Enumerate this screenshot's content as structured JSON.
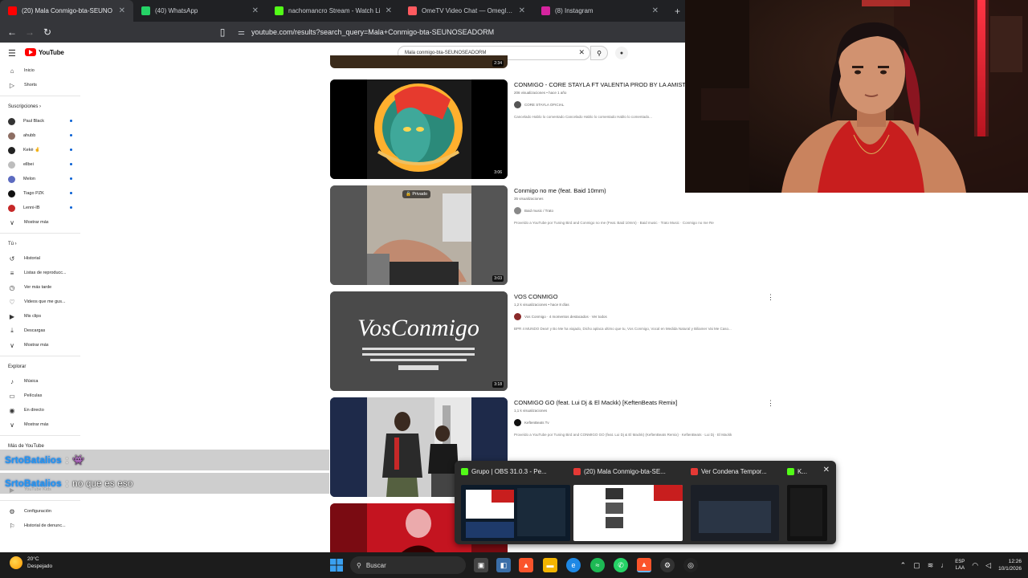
{
  "browser": {
    "tabs": [
      {
        "label": "(20) Mala Conmigo-bta-SEUNO",
        "color": "#ff0000",
        "active": true
      },
      {
        "label": "(40) WhatsApp",
        "color": "#25d366",
        "active": false
      },
      {
        "label": "nachomancro Stream - Watch Li",
        "color": "#53fc18",
        "active": false
      },
      {
        "label": "OmeTV Video Chat — Omegle Rand",
        "color": "#ff5a5f",
        "active": false
      },
      {
        "label": "(8) Instagram",
        "color": "#d6249f",
        "active": false
      }
    ],
    "new_tab": "+",
    "url": "youtube.com/results?search_query=Mala+Conmigo-bta-SEUNOSEADORM"
  },
  "youtube": {
    "logo_text": "YouTube",
    "search_value": "Mala conmigo-bta-SEUNOSEADORM",
    "sidebar": {
      "main": [
        {
          "icon": "⌂",
          "label": "Inicio"
        },
        {
          "icon": "▷",
          "label": "Shorts"
        }
      ],
      "subs_header": "Suscripciones ›",
      "subs": [
        {
          "label": "Paul Black",
          "color": "#333"
        },
        {
          "label": "ahubb",
          "color": "#8d6e63"
        },
        {
          "label": "Kekè ✌",
          "color": "#222"
        },
        {
          "label": "ellbei",
          "color": "#bdbdbd"
        },
        {
          "label": "Melon",
          "color": "#5c6bc0"
        },
        {
          "label": "Tiago PZK",
          "color": "#111"
        },
        {
          "label": "Lenni-IB",
          "color": "#c62828"
        }
      ],
      "subs_more": "Mostrar más",
      "you_header": "Tú ›",
      "you": [
        {
          "icon": "↺",
          "label": "Historial"
        },
        {
          "icon": "≡",
          "label": "Listas de reproducc..."
        },
        {
          "icon": "◷",
          "label": "Ver más tarde"
        },
        {
          "icon": "♡",
          "label": "Videos que me gus..."
        },
        {
          "icon": "▶",
          "label": "Mis clips"
        },
        {
          "icon": "⤓",
          "label": "Descargas"
        },
        {
          "icon": "∨",
          "label": "Mostrar más"
        }
      ],
      "explore_header": "Explorar",
      "explore": [
        {
          "icon": "♪",
          "label": "Música"
        },
        {
          "icon": "▭",
          "label": "Películas"
        },
        {
          "icon": "◉",
          "label": "En directo"
        },
        {
          "icon": "∨",
          "label": "Mostrar más"
        }
      ],
      "more_header": "Más de YouTube",
      "more": [
        {
          "icon": "▶",
          "label": "YouTube Kids"
        }
      ],
      "settings": [
        {
          "icon": "⚙",
          "label": "Configuración"
        },
        {
          "icon": "⚐",
          "label": "Historial de denunc..."
        }
      ]
    },
    "results": [
      {
        "title": "CONMIGO - CORE STAYLA FT VALENTIA PROD BY LA AMISTA",
        "meta": "206 visualizaciones • hace 1 año",
        "channel": "CORE STAYLA OFICIAL",
        "description": "Cancelado Hablo lo comentado Cancelado Hablo lo comentado Hablo lo comentado...",
        "duration": "3:06"
      },
      {
        "title": "Conmigo no me (feat. Baid 10mm)",
        "meta": "35 visualizaciones",
        "channel": "Baid music / Trato",
        "description": "Proveído a YouTube por Tuning Bird and Conmigo no me (Feat. Baid 10mm) · Baid music · Trato Music · Conmigo no me Re",
        "duration": "3:03",
        "private_label": "🔒 Privado"
      },
      {
        "title": "VOS CONMIGO",
        "meta": "1,2 k visualizaciones • hace 8 días",
        "channel": "Vos Conmigo · 4 momentos destacados · Ver todos",
        "description": "BPR 4 MUNDO Dear! y Bo Me ha viajado, Dicho aplaca ultimo que tu, Vos Conmigo, Vocal en Medida Natural y Biliamer Vai Me Caso...",
        "duration": "3:18"
      },
      {
        "title": "CONMIGO GO (feat. Lui Dj & El Mackk) [KeftenBeats Remix]",
        "meta": "1,1 k visualizaciones",
        "channel": "KeftenBeats Tv",
        "description": "Proveído a YouTube por Tuning Bird and CONMIGO GO (feat. Lui Dj & El Mackk) (KeftenBeats Remix) · KeftenBeats · Lui Dj · El Mackk",
        "duration": "2:57"
      }
    ],
    "top_partial_duration": "2:34"
  },
  "chat": [
    {
      "user": "SrtoBatalios",
      "sep": ":",
      "message": "👾"
    },
    {
      "user": "SrtoBatalios",
      "sep": ":",
      "message": "no que es eso"
    }
  ],
  "taskbar_popup": {
    "windows": [
      {
        "title": "Grupo | OBS 31.0.3 - Pe...",
        "color": "#53fc18"
      },
      {
        "title": "(20) Mala Conmigo-bta-SE...",
        "color": "#e53935"
      },
      {
        "title": "Ver Condena Tempor...",
        "color": "#e53935"
      },
      {
        "title": "K...",
        "color": "#53fc18"
      }
    ],
    "close": "✕"
  },
  "taskbar": {
    "weather_temp": "20°C",
    "weather_desc": "Despejado",
    "search_placeholder": "Buscar",
    "lang_top": "ESP",
    "lang_bottom": "LAA",
    "time": "12:26",
    "date": "10/1/2026"
  }
}
